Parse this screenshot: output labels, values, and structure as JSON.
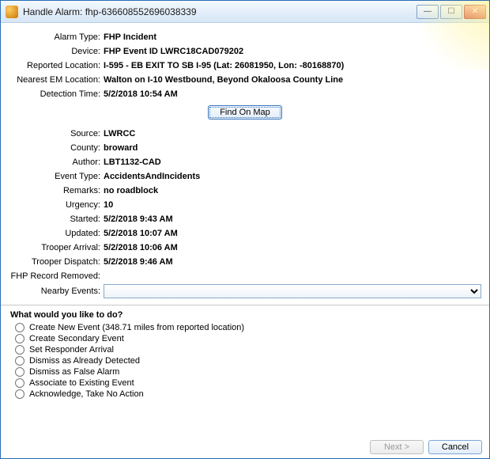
{
  "window": {
    "title": "Handle Alarm: fhp-636608552696038339"
  },
  "fields": {
    "alarm_type": {
      "label": "Alarm Type:",
      "value": "FHP Incident"
    },
    "device": {
      "label": "Device:",
      "value": "FHP Event ID LWRC18CAD079202"
    },
    "reported_location": {
      "label": "Reported Location:",
      "value": "I-595 - EB EXIT TO SB I-95 (Lat: 26081950, Lon: -80168870)"
    },
    "nearest_em": {
      "label": "Nearest EM Location:",
      "value": "Walton on I-10 Westbound, Beyond Okaloosa County Line"
    },
    "detection_time": {
      "label": "Detection Time:",
      "value": "5/2/2018 10:54 AM"
    },
    "source": {
      "label": "Source:",
      "value": "LWRCC"
    },
    "county": {
      "label": "County:",
      "value": "broward"
    },
    "author": {
      "label": "Author:",
      "value": "LBT1132-CAD"
    },
    "event_type": {
      "label": "Event Type:",
      "value": "AccidentsAndIncidents"
    },
    "remarks": {
      "label": "Remarks:",
      "value": "no roadblock"
    },
    "urgency": {
      "label": "Urgency:",
      "value": "10"
    },
    "started": {
      "label": "Started:",
      "value": "5/2/2018 9:43 AM"
    },
    "updated": {
      "label": "Updated:",
      "value": "5/2/2018 10:07 AM"
    },
    "trooper_arrival": {
      "label": "Trooper Arrival:",
      "value": "5/2/2018 10:06 AM"
    },
    "trooper_dispatch": {
      "label": "Trooper Dispatch:",
      "value": "5/2/2018 9:46 AM"
    },
    "fhp_removed": {
      "label": "FHP Record Removed:",
      "value": ""
    },
    "nearby_events": {
      "label": "Nearby Events:"
    }
  },
  "buttons": {
    "find_on_map": "Find On Map",
    "next": "Next >",
    "cancel": "Cancel"
  },
  "action_section": {
    "heading": "What would you like to do?",
    "options": [
      "Create New Event (348.71 miles from reported location)",
      "Create Secondary Event",
      "Set Responder Arrival",
      "Dismiss as Already Detected",
      "Dismiss as False Alarm",
      "Associate to Existing Event",
      "Acknowledge, Take No Action"
    ]
  }
}
